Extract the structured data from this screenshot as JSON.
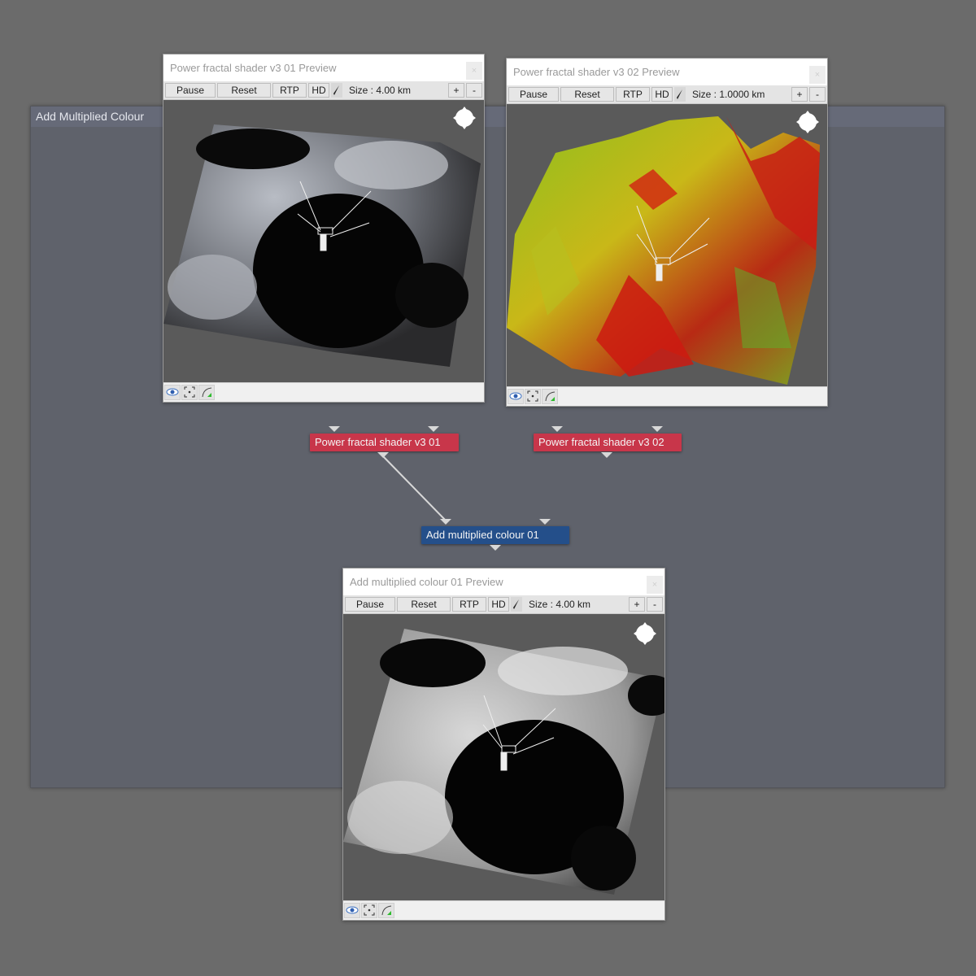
{
  "group": {
    "title": "Add Multiplied Colour"
  },
  "previews": [
    {
      "title": "Power fractal shader v3 01 Preview",
      "close": "×",
      "buttons": {
        "pause": "Pause",
        "reset": "Reset",
        "rtp": "RTP",
        "hd": "HD",
        "plus": "+",
        "minus": "-"
      },
      "size": "Size : 4.00 km",
      "render": "grayscale-terrain"
    },
    {
      "title": "Power fractal shader v3 02 Preview",
      "close": "×",
      "buttons": {
        "pause": "Pause",
        "reset": "Reset",
        "rtp": "RTP",
        "hd": "HD",
        "plus": "+",
        "minus": "-"
      },
      "size": "Size : 1.0000 km",
      "render": "red-yellow-green-terrain"
    },
    {
      "title": "Add multiplied colour 01 Preview",
      "close": "×",
      "buttons": {
        "pause": "Pause",
        "reset": "Reset",
        "rtp": "RTP",
        "hd": "HD",
        "plus": "+",
        "minus": "-"
      },
      "size": "Size : 4.00 km",
      "render": "grayscale-heightmap"
    }
  ],
  "statusbar_icons": [
    "eye-icon",
    "frame-icon",
    "curve-icon"
  ],
  "nodes": [
    {
      "label": "Power fractal shader v3 01",
      "color": "#c8364a"
    },
    {
      "label": "Power fractal shader v3 02",
      "color": "#c8364a"
    },
    {
      "label": "Add multiplied colour 01",
      "color": "#244f8a"
    }
  ],
  "connections": [
    {
      "from": "Power fractal shader v3 01",
      "to": "Add multiplied colour 01"
    }
  ]
}
